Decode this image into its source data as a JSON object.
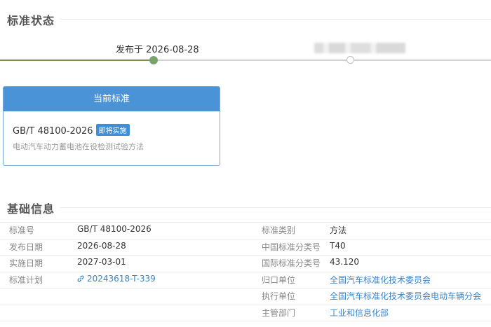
{
  "standard_status": {
    "title": "标准状态",
    "published_label": "发布于 2026-08-28"
  },
  "current_standard": {
    "header": "当前标准",
    "code": "GB/T 48100-2026",
    "badge": "即将实施",
    "description": "电动汽车动力蓄电池在役检测试验方法"
  },
  "basic_info": {
    "title": "基础信息",
    "left": [
      {
        "label": "标准号",
        "value": "GB/T 48100-2026"
      },
      {
        "label": "发布日期",
        "value": "2026-08-28"
      },
      {
        "label": "实施日期",
        "value": "2027-03-01"
      },
      {
        "label": "标准计划",
        "value": "20243618-T-339",
        "link": true
      }
    ],
    "right": [
      {
        "label": "标准类别",
        "value": "方法"
      },
      {
        "label": "中国标准分类号",
        "value": "T40"
      },
      {
        "label": "国际标准分类号",
        "value": "43.120"
      },
      {
        "label": "归口单位",
        "value": "全国汽车标准化技术委员会",
        "link": true
      },
      {
        "label": "执行单位",
        "value": "全国汽车标准化技术委员会电动车辆分会",
        "link": true
      },
      {
        "label": "主管部门",
        "value": "工业和信息化部",
        "link": true
      }
    ]
  },
  "colors": {
    "accent_blue": "#4a93d6",
    "link_blue": "#3a83c8",
    "timeline_done": "#7aa36b"
  }
}
